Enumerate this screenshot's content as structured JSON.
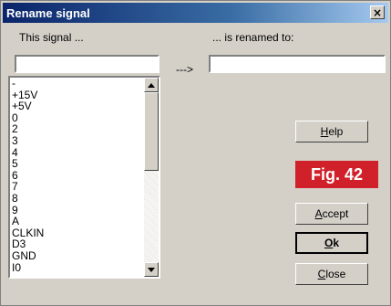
{
  "window": {
    "title": "Rename signal",
    "close_glyph": "×"
  },
  "from": {
    "label": "This signal ...",
    "value": ""
  },
  "arrow": "--->",
  "to": {
    "label": "... is renamed to:",
    "value": ""
  },
  "signals": [
    "-",
    "+15V",
    "+5V",
    "0",
    "2",
    "3",
    "4",
    "5",
    "6",
    "7",
    "8",
    "9",
    "A",
    "CLKIN",
    "D3",
    "GND",
    "I0"
  ],
  "buttons": {
    "help": {
      "first": "H",
      "rest": "elp"
    },
    "accept": {
      "first": "A",
      "rest": "ccept"
    },
    "ok": {
      "first": "O",
      "rest": "k"
    },
    "close": {
      "first": "C",
      "rest": "lose"
    }
  },
  "figure_badge": "Fig. 42",
  "colors": {
    "badge": "#d0202a",
    "titlebar": "#0a246a",
    "face": "#d4d0c8"
  }
}
